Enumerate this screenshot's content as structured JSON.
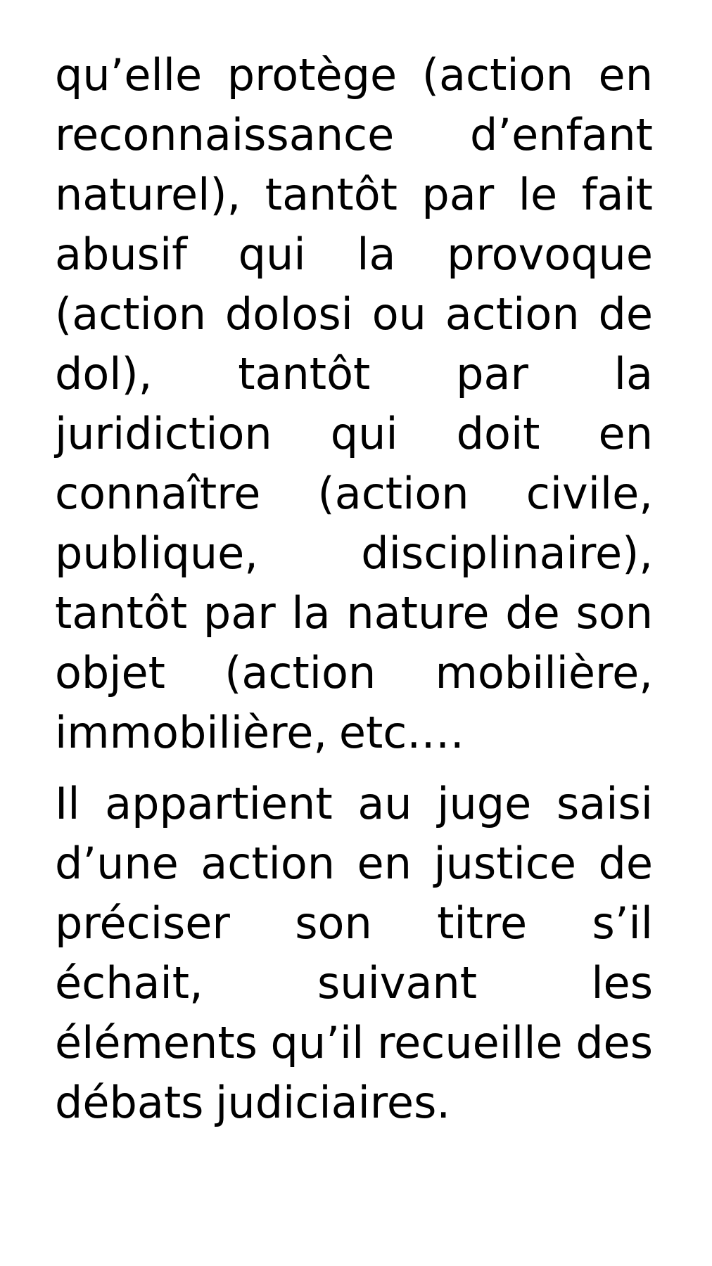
{
  "document": {
    "paragraphs": [
      "qu’elle protège (action en reconnaissance d’enfant naturel), tantôt par le fait abusif qui la provoque (action dolosi ou action de dol), tantôt par la juridiction qui doit en connaître (action civile,  publique, disciplinaire), tantôt par la nature de son objet (action mobilière, immobilière, etc.…",
      "Il appartient au juge saisi d’une action en justice de préciser son titre s’il échait, suivant les éléments qu’il recueille des débats judiciaires."
    ]
  }
}
